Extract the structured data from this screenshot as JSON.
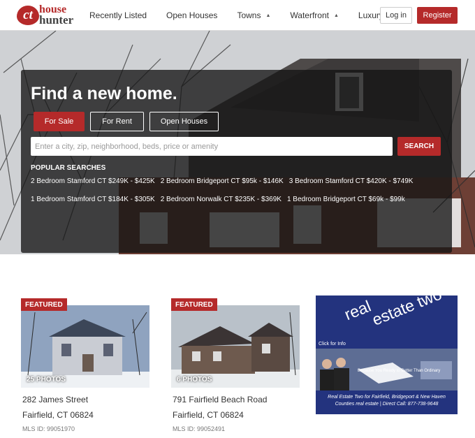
{
  "brand": {
    "badge": "ct",
    "word1": "house",
    "word2": "hunter",
    "accent_color": "#b52a2a"
  },
  "nav": {
    "items": [
      {
        "label": "Recently Listed",
        "dropdown": false
      },
      {
        "label": "Open Houses",
        "dropdown": false
      },
      {
        "label": "Towns",
        "dropdown": true
      },
      {
        "label": "Waterfront",
        "dropdown": true
      },
      {
        "label": "Luxury",
        "dropdown": false
      }
    ],
    "login_label": "Log in",
    "register_label": "Register"
  },
  "hero": {
    "title": "Find a new home.",
    "tabs": [
      {
        "label": "For Sale",
        "active": true
      },
      {
        "label": "For Rent",
        "active": false
      },
      {
        "label": "Open Houses",
        "active": false
      }
    ],
    "search_placeholder": "Enter a city, zip, neighborhood, beds, price or amenity",
    "search_button": "SEARCH",
    "popular_heading": "POPULAR SEARCHES",
    "popular_searches": [
      [
        "2 Bedroom Stamford CT $249K - $425K",
        "2 Bedroom Bridgeport CT $95k - $146K",
        "3 Bedroom Stamford CT $420K - $749K"
      ],
      [
        "1 Bedroom Stamford CT $184K - $305K",
        "2 Bedroom Norwalk CT $235K - $369K",
        "1 Bedroom Bridgeport CT $69k - $99k"
      ]
    ]
  },
  "listings": [
    {
      "badge": "FEATURED",
      "photos": "25 PHOTOS",
      "street": "282 James Street",
      "city": "Fairfield, CT 06824",
      "mls": "MLS ID: 99051970"
    },
    {
      "badge": "FEATURED",
      "photos": "6 PHOTOS",
      "street": "791 Fairfield Beach Road",
      "city": "Fairfield, CT 06824",
      "mls": "MLS ID: 99052491"
    }
  ],
  "ad": {
    "logo_line1": "real",
    "logo_line2": "estate two",
    "click_info": "Click for Info",
    "tagline": "Because You Ready to Better Than Ordinary",
    "caption1": "Real Estate Two for Fairfield, Bridgeport & New Haven",
    "caption2": "Counties real estate | Direct Call: 877-738-9648",
    "bg_color": "#23337e"
  }
}
